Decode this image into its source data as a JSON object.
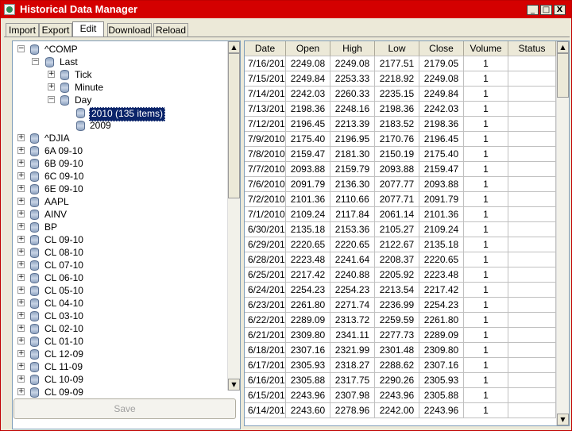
{
  "window": {
    "title": "Historical Data Manager",
    "minimize": "_",
    "maximize": "□",
    "close": "X"
  },
  "tabs": [
    "Import",
    "Export",
    "Edit",
    "Download",
    "Reload"
  ],
  "tree": {
    "root": "^COMP",
    "last": "Last",
    "tick": "Tick",
    "minute": "Minute",
    "day": "Day",
    "selected_year": "2010 (135 items)",
    "other_year": "2009",
    "symbols": [
      "^DJIA",
      "6A 09-10",
      "6B 09-10",
      "6C 09-10",
      "6E 09-10",
      "AAPL",
      "AINV",
      "BP",
      "CL 09-10",
      "CL 08-10",
      "CL 07-10",
      "CL 06-10",
      "CL 05-10",
      "CL 04-10",
      "CL 03-10",
      "CL 02-10",
      "CL 01-10",
      "CL 12-09",
      "CL 11-09",
      "CL 10-09",
      "CL 09-09"
    ],
    "expand_glyph": "+",
    "collapse_glyph": "−"
  },
  "save_label": "Save",
  "scroll": {
    "up": "▲",
    "down": "▼"
  },
  "grid": {
    "columns": [
      "Date",
      "Open",
      "High",
      "Low",
      "Close",
      "Volume",
      "Status"
    ],
    "rows": [
      [
        "7/16/201",
        "2249.08",
        "2249.08",
        "2177.51",
        "2179.05",
        "1",
        ""
      ],
      [
        "7/15/201",
        "2249.84",
        "2253.33",
        "2218.92",
        "2249.08",
        "1",
        ""
      ],
      [
        "7/14/201",
        "2242.03",
        "2260.33",
        "2235.15",
        "2249.84",
        "1",
        ""
      ],
      [
        "7/13/201",
        "2198.36",
        "2248.16",
        "2198.36",
        "2242.03",
        "1",
        ""
      ],
      [
        "7/12/201",
        "2196.45",
        "2213.39",
        "2183.52",
        "2198.36",
        "1",
        ""
      ],
      [
        "7/9/2010",
        "2175.40",
        "2196.95",
        "2170.76",
        "2196.45",
        "1",
        ""
      ],
      [
        "7/8/2010",
        "2159.47",
        "2181.30",
        "2150.19",
        "2175.40",
        "1",
        ""
      ],
      [
        "7/7/2010",
        "2093.88",
        "2159.79",
        "2093.88",
        "2159.47",
        "1",
        ""
      ],
      [
        "7/6/2010",
        "2091.79",
        "2136.30",
        "2077.77",
        "2093.88",
        "1",
        ""
      ],
      [
        "7/2/2010",
        "2101.36",
        "2110.66",
        "2077.71",
        "2091.79",
        "1",
        ""
      ],
      [
        "7/1/2010",
        "2109.24",
        "2117.84",
        "2061.14",
        "2101.36",
        "1",
        ""
      ],
      [
        "6/30/201",
        "2135.18",
        "2153.36",
        "2105.27",
        "2109.24",
        "1",
        ""
      ],
      [
        "6/29/201",
        "2220.65",
        "2220.65",
        "2122.67",
        "2135.18",
        "1",
        ""
      ],
      [
        "6/28/201",
        "2223.48",
        "2241.64",
        "2208.37",
        "2220.65",
        "1",
        ""
      ],
      [
        "6/25/201",
        "2217.42",
        "2240.88",
        "2205.92",
        "2223.48",
        "1",
        ""
      ],
      [
        "6/24/201",
        "2254.23",
        "2254.23",
        "2213.54",
        "2217.42",
        "1",
        ""
      ],
      [
        "6/23/201",
        "2261.80",
        "2271.74",
        "2236.99",
        "2254.23",
        "1",
        ""
      ],
      [
        "6/22/201",
        "2289.09",
        "2313.72",
        "2259.59",
        "2261.80",
        "1",
        ""
      ],
      [
        "6/21/201",
        "2309.80",
        "2341.11",
        "2277.73",
        "2289.09",
        "1",
        ""
      ],
      [
        "6/18/201",
        "2307.16",
        "2321.99",
        "2301.48",
        "2309.80",
        "1",
        ""
      ],
      [
        "6/17/201",
        "2305.93",
        "2318.27",
        "2288.62",
        "2307.16",
        "1",
        ""
      ],
      [
        "6/16/201",
        "2305.88",
        "2317.75",
        "2290.26",
        "2305.93",
        "1",
        ""
      ],
      [
        "6/15/201",
        "2243.96",
        "2307.98",
        "2243.96",
        "2305.88",
        "1",
        ""
      ],
      [
        "6/14/201",
        "2243.60",
        "2278.96",
        "2242.00",
        "2243.96",
        "1",
        ""
      ]
    ]
  }
}
